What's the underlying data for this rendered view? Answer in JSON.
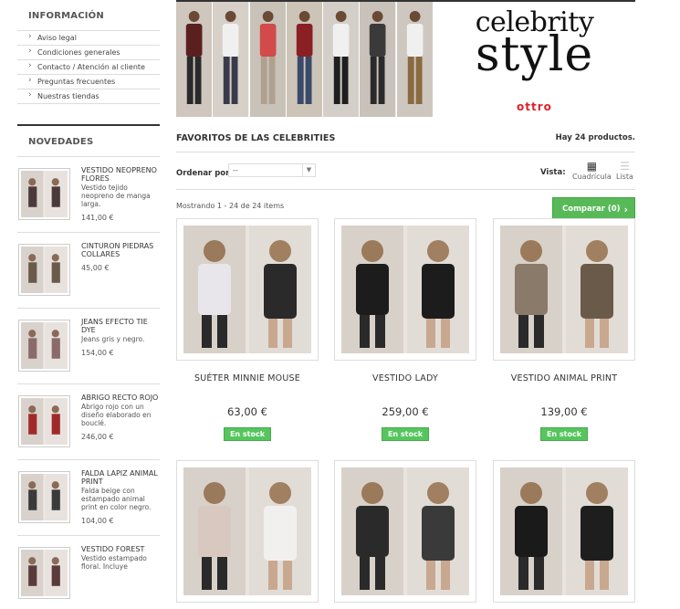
{
  "sidebar": {
    "info_title": "INFORMACIÓN",
    "info_links": [
      {
        "label": "Aviso legal"
      },
      {
        "label": "Condiciones generales"
      },
      {
        "label": "Contacto / Atención al cliente"
      },
      {
        "label": "Preguntas frecuentes"
      },
      {
        "label": "Nuestras tiendas"
      }
    ],
    "novedades_title": "NOVEDADES",
    "novedades": [
      {
        "name": "VESTIDO NEOPRENO FLORES",
        "desc": "Vestido tejido neopreno de manga larga.",
        "price": "141,00 €",
        "thumb_color": "#4a3a3a"
      },
      {
        "name": "CINTURON PIEDRAS COLLARES",
        "desc": "",
        "price": "45,00 €",
        "thumb_color": "#6a5a4a"
      },
      {
        "name": "JEANS EFECTO TIE DYE",
        "desc": "Jeans gris y negro.",
        "price": "154,00 €",
        "thumb_color": "#8a6a6a"
      },
      {
        "name": "ABRIGO RECTO ROJO",
        "desc": "Abrigo rojo con un diseño elaborado en bouclé.",
        "price": "246,00 €",
        "thumb_color": "#a02a2a"
      },
      {
        "name": "FALDA LAPIZ ANIMAL PRINT",
        "desc": "Falda beige con estampado animal print en color negro.",
        "price": "104,00 €",
        "thumb_color": "#3a3a3a"
      },
      {
        "name": "VESTIDO FOREST",
        "desc": "Vestido estampado floral. Incluye",
        "price": "",
        "thumb_color": "#5a3a3a"
      }
    ]
  },
  "banner": {
    "brand_line1": "celebrity",
    "brand_line2": "style",
    "brand_logo": "ottro"
  },
  "category": {
    "title": "FAVORITOS DE LAS CELEBRITIES",
    "count": "Hay 24 productos.",
    "sort_label": "Ordenar por",
    "sort_value": "--",
    "view_label": "Vista:",
    "view_grid": "Cuadrícula",
    "view_list": "Lista",
    "showing": "Mostrando 1 - 24 de 24 items",
    "compare": "Comparar (0)"
  },
  "products": [
    {
      "name": "SUÉTER MINNIE MOUSE",
      "price": "63,00 €",
      "stock": "En stock",
      "colors": [
        "#e8e6ea",
        "#2a2a2a"
      ]
    },
    {
      "name": "VESTIDO LADY",
      "price": "259,00 €",
      "stock": "En stock",
      "colors": [
        "#1c1c1c",
        "#1c1c1c"
      ]
    },
    {
      "name": "VESTIDO ANIMAL PRINT",
      "price": "139,00 €",
      "stock": "En stock",
      "colors": [
        "#8a7a6a",
        "#6a5a4a"
      ]
    },
    {
      "name": "",
      "price": "",
      "stock": "",
      "colors": [
        "#d8c8c0",
        "#f2f0ee"
      ]
    },
    {
      "name": "",
      "price": "",
      "stock": "",
      "colors": [
        "#2a2a2a",
        "#3a3a3a"
      ]
    },
    {
      "name": "",
      "price": "",
      "stock": "",
      "colors": [
        "#1a1a1a",
        "#1e1e1e"
      ]
    }
  ]
}
